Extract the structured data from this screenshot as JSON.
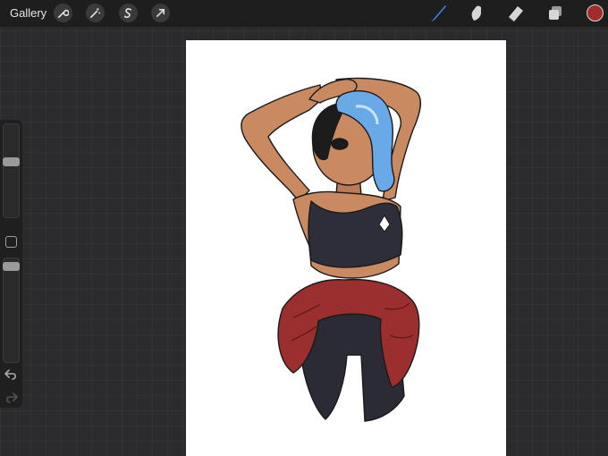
{
  "topbar": {
    "gallery_label": "Gallery",
    "left_tools": [
      "wrench-icon",
      "magic-wand-icon",
      "selection-s-icon",
      "transform-arrow-icon"
    ],
    "right_tools": [
      "brush-icon",
      "smudge-icon",
      "eraser-icon",
      "layers-icon"
    ],
    "active_tool": "brush-icon",
    "current_color": "#a02c2c"
  },
  "sidebar": {
    "brush_size_level": 0.6,
    "opacity_level": 0.95
  },
  "colors": {
    "accent": "#3d8ef7",
    "skin": "#c98a62",
    "hair": "#6aa9e8",
    "top": "#2e2d3a",
    "jacket": "#9b2f2f"
  }
}
